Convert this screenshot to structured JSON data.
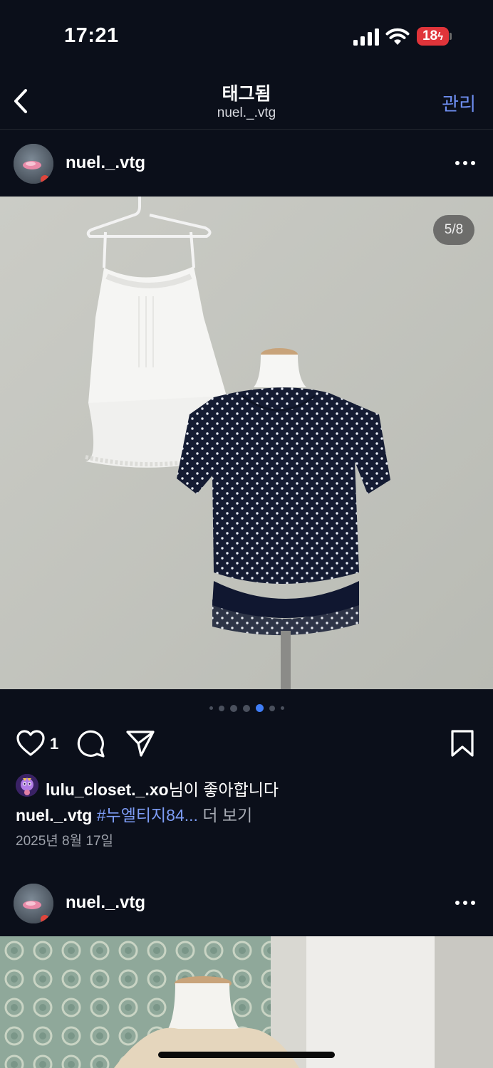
{
  "status_bar": {
    "time": "17:21",
    "battery": "18",
    "icons": [
      "signal-icon",
      "wifi-icon",
      "battery-charging-icon"
    ]
  },
  "header": {
    "back_icon": "chevron-left-icon",
    "title": "태그됨",
    "subtitle": "nuel._.vtg",
    "manage_label": "관리"
  },
  "posts": [
    {
      "username": "nuel._.vtg",
      "more_icon": "more-horizontal-icon",
      "image_description_icon": "photo",
      "page_indicator": "5/8",
      "carousel": {
        "total": 8,
        "active_index": 4
      },
      "like_count": "1",
      "liked_by_user": "lulu_closet._.xo",
      "liked_by_suffix": "님이 좋아합니다",
      "caption_user": "nuel._.vtg",
      "caption_text": "#누엘티지84...",
      "more_label": "더 보기",
      "date": "2025년 8월 17일"
    },
    {
      "username": "nuel._.vtg",
      "more_icon": "more-horizontal-icon"
    }
  ],
  "colors": {
    "background": "#0b0f1a",
    "accent": "#6f8ff2",
    "hashtag": "#7d9cf5",
    "active_dot": "#3f7df6",
    "battery_low": "#e0343a"
  }
}
